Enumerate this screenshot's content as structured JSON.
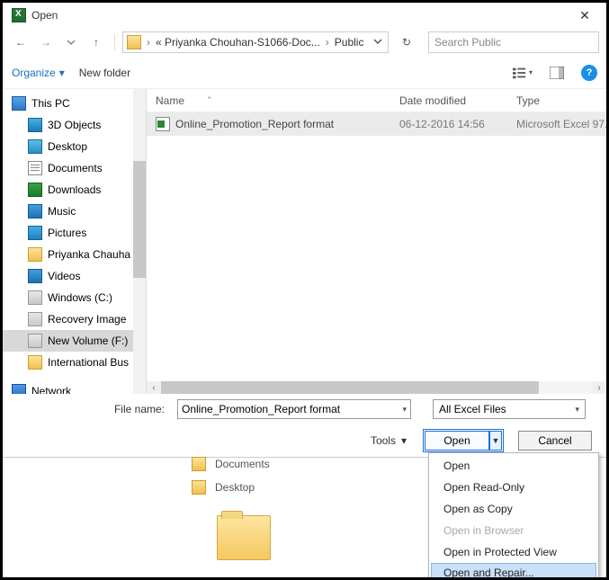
{
  "title": "Open",
  "breadcrumb": {
    "a": "« Priyanka Chouhan-S1066-Doc...",
    "b": "Public"
  },
  "search_placeholder": "Search Public",
  "toolbar": {
    "organize": "Organize",
    "newfolder": "New folder"
  },
  "columns": {
    "name": "Name",
    "date": "Date modified",
    "type": "Type"
  },
  "tree": {
    "thispc": "This PC",
    "threed": "3D Objects",
    "desktop": "Desktop",
    "documents": "Documents",
    "downloads": "Downloads",
    "music": "Music",
    "pictures": "Pictures",
    "priyanka": "Priyanka Chauha",
    "videos": "Videos",
    "winc": "Windows (C:)",
    "recov": "Recovery Image",
    "newvol": "New Volume (F:)",
    "intl": "International Bus",
    "network": "Network"
  },
  "file": {
    "name": "Online_Promotion_Report  format",
    "date": "06-12-2016 14:56",
    "type": "Microsoft Excel 97..."
  },
  "filerow": {
    "label": "File name:",
    "value": "Online_Promotion_Report  format",
    "filter": "All Excel Files"
  },
  "buttons": {
    "tools": "Tools",
    "open": "Open",
    "cancel": "Cancel"
  },
  "menu": {
    "open": "Open",
    "readonly": "Open Read-Only",
    "copy": "Open as Copy",
    "browser": "Open in Browser",
    "protected": "Open in Protected View",
    "repair": "Open and Repair..."
  },
  "behind": {
    "documents": "Documents",
    "desktop": "Desktop"
  }
}
